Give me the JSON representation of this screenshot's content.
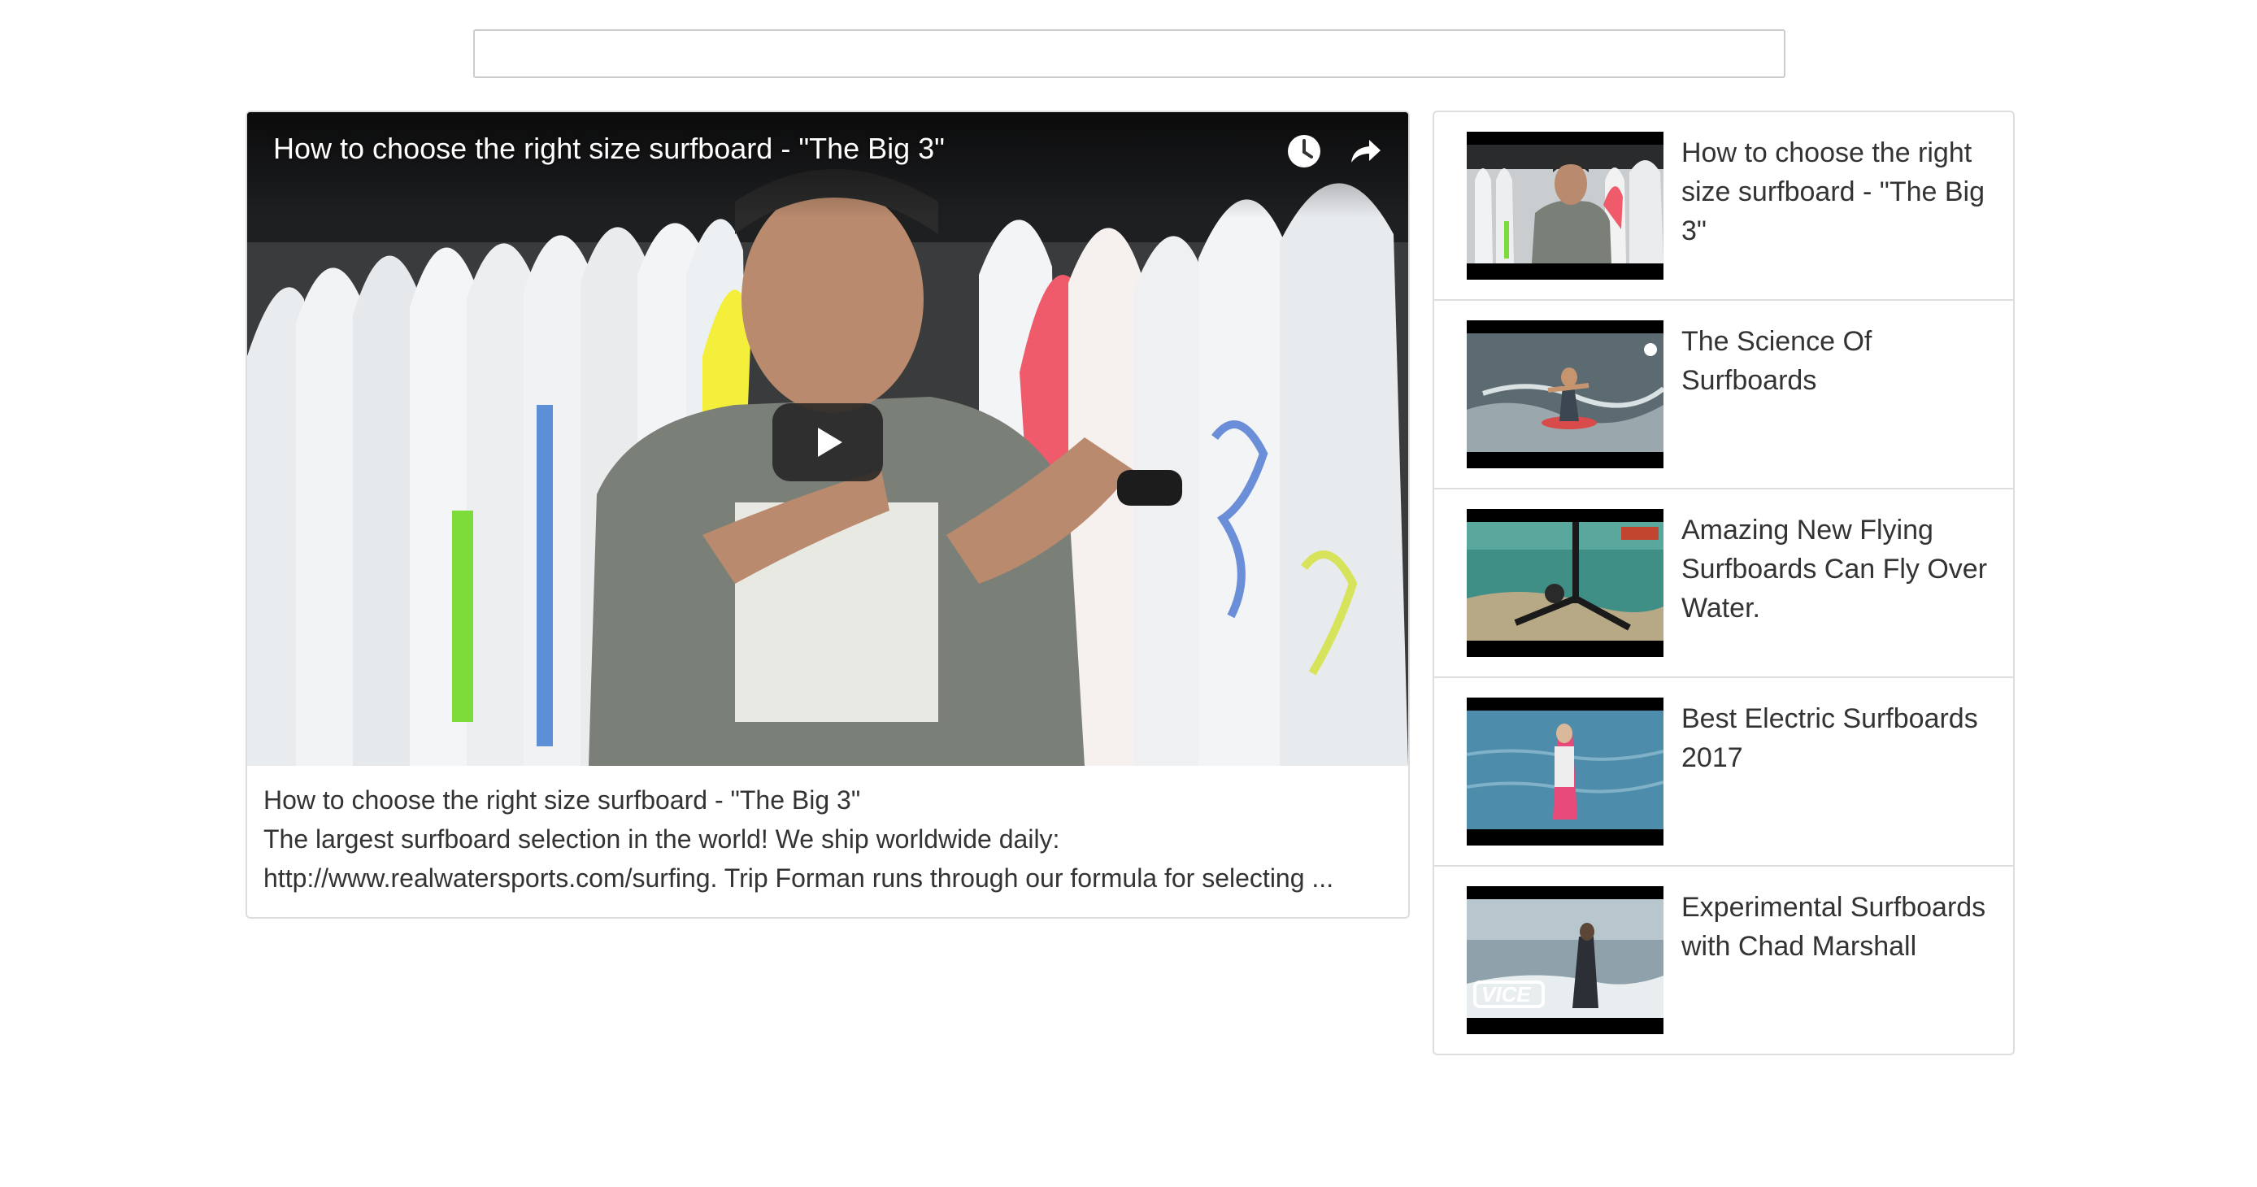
{
  "search": {
    "placeholder": "",
    "value": ""
  },
  "player": {
    "title": "How to choose the right size surfboard - \"The Big 3\"",
    "controls": {
      "watch_later_icon": "clock-icon",
      "share_icon": "share-arrow-icon",
      "play_icon": "play-icon"
    }
  },
  "video_info": {
    "title": "How to choose the right size surfboard - \"The Big 3\"",
    "description_line1": "The largest surfboard selection in the world! We ship worldwide daily:",
    "description_line2": "http://www.realwatersports.com/surfing. Trip Forman runs through our formula for selecting ..."
  },
  "playlist": {
    "items": [
      {
        "title": "How to choose the right size surfboard - \"The Big 3\""
      },
      {
        "title": "The Science Of Surfboards"
      },
      {
        "title": "Amazing New Flying Surfboards Can Fly Over Water."
      },
      {
        "title": "Best Electric Surfboards 2017"
      },
      {
        "title": "Experimental Surfboards with Chad Marshall"
      }
    ],
    "thumb_badges": {
      "vice_logo": "VICE"
    }
  }
}
